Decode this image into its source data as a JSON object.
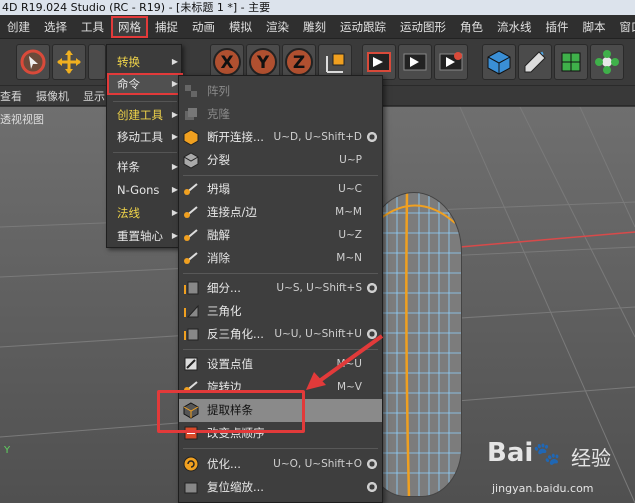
{
  "titlebar": {
    "text": "4D R19.024 Studio (RC - R19) - [未标题 1 *] - 主要"
  },
  "menubar": {
    "items": [
      "创建",
      "选择",
      "工具",
      "网格",
      "捕捉",
      "动画",
      "模拟",
      "渲染",
      "雕刻",
      "运动跟踪",
      "运动图形",
      "角色",
      "流水线",
      "插件",
      "脚本",
      "窗口"
    ],
    "active_index": 3
  },
  "toolbar": {
    "icons": [
      "cursor-icon",
      "move-icon",
      "axis-x-icon",
      "axis-y-icon",
      "axis-z-icon",
      "coordinate-icon",
      "model-icon",
      "render-icon",
      "render-view-icon",
      "render-settings-icon",
      "cube-icon",
      "pen-icon",
      "subdivide-icon",
      "cloner-icon",
      "flower-icon"
    ]
  },
  "subbar": {
    "items": [
      "查看",
      "摄像机",
      "显示"
    ]
  },
  "viewport": {
    "label": "透视视图"
  },
  "mesh_menu": {
    "items": [
      {
        "label": "转换",
        "color": "yellow",
        "arrow": "▶"
      },
      {
        "label": "命令",
        "color": "white",
        "arrow": "▶",
        "selected": true
      },
      {
        "label": "创建工具",
        "color": "yellow",
        "arrow": "▶"
      },
      {
        "label": "移动工具",
        "color": "white",
        "arrow": "▶"
      },
      {
        "label": "样条",
        "color": "white",
        "arrow": "▶"
      },
      {
        "label": "N-Gons",
        "color": "white",
        "arrow": "▶"
      },
      {
        "label": "法线",
        "color": "yellow",
        "arrow": "▶"
      },
      {
        "label": "重置轴心",
        "color": "white",
        "arrow": "▶"
      }
    ]
  },
  "commands_menu": {
    "items": [
      {
        "label": "阵列",
        "shortcut": "",
        "disabled": true,
        "icon": "array-icon"
      },
      {
        "label": "克隆",
        "shortcut": "",
        "disabled": true,
        "icon": "clone-icon"
      },
      {
        "label": "断开连接...",
        "shortcut": "U~D, U~Shift+D",
        "gear": true,
        "icon": "disconnect-icon"
      },
      {
        "label": "分裂",
        "shortcut": "U~P",
        "icon": "split-icon"
      },
      {
        "label": "坍塌",
        "shortcut": "U~C",
        "icon": "collapse-icon"
      },
      {
        "label": "连接点/边",
        "shortcut": "M~M",
        "icon": "connect-icon"
      },
      {
        "label": "融解",
        "shortcut": "U~Z",
        "icon": "melt-icon"
      },
      {
        "label": "消除",
        "shortcut": "M~N",
        "icon": "dissolve-icon"
      },
      {
        "label": "细分...",
        "shortcut": "U~S, U~Shift+S",
        "gear": true,
        "icon": "subdivide-icon"
      },
      {
        "label": "三角化",
        "shortcut": "",
        "icon": "triangulate-icon"
      },
      {
        "label": "反三角化...",
        "shortcut": "U~U, U~Shift+U",
        "gear": true,
        "icon": "untriangulate-icon"
      },
      {
        "label": "设置点值",
        "shortcut": "M~U",
        "icon": "set-point-icon"
      },
      {
        "label": "旋转边",
        "shortcut": "M~V",
        "icon": "spin-edge-icon"
      },
      {
        "label": "提取样条",
        "shortcut": "",
        "highlighted": true,
        "icon": "edge-to-spline-icon"
      },
      {
        "label": "改变点顺序",
        "shortcut": "",
        "icon": "change-point-order-icon"
      },
      {
        "label": "优化...",
        "shortcut": "U~O, U~Shift+O",
        "gear": true,
        "icon": "optimize-icon"
      },
      {
        "label": "复位缩放...",
        "shortcut": "",
        "gear": true,
        "icon": "reset-scale-icon"
      }
    ]
  },
  "watermark": {
    "logo": "Bai",
    "cn": "经验",
    "url": "jingyan.baidu.com"
  },
  "axis_label": "Y",
  "colors": {
    "accent_red": "#e23a3a",
    "menu_yellow": "#f1d54a",
    "wire_blue": "#7ec8ff",
    "edge_orange": "#f0a020"
  }
}
